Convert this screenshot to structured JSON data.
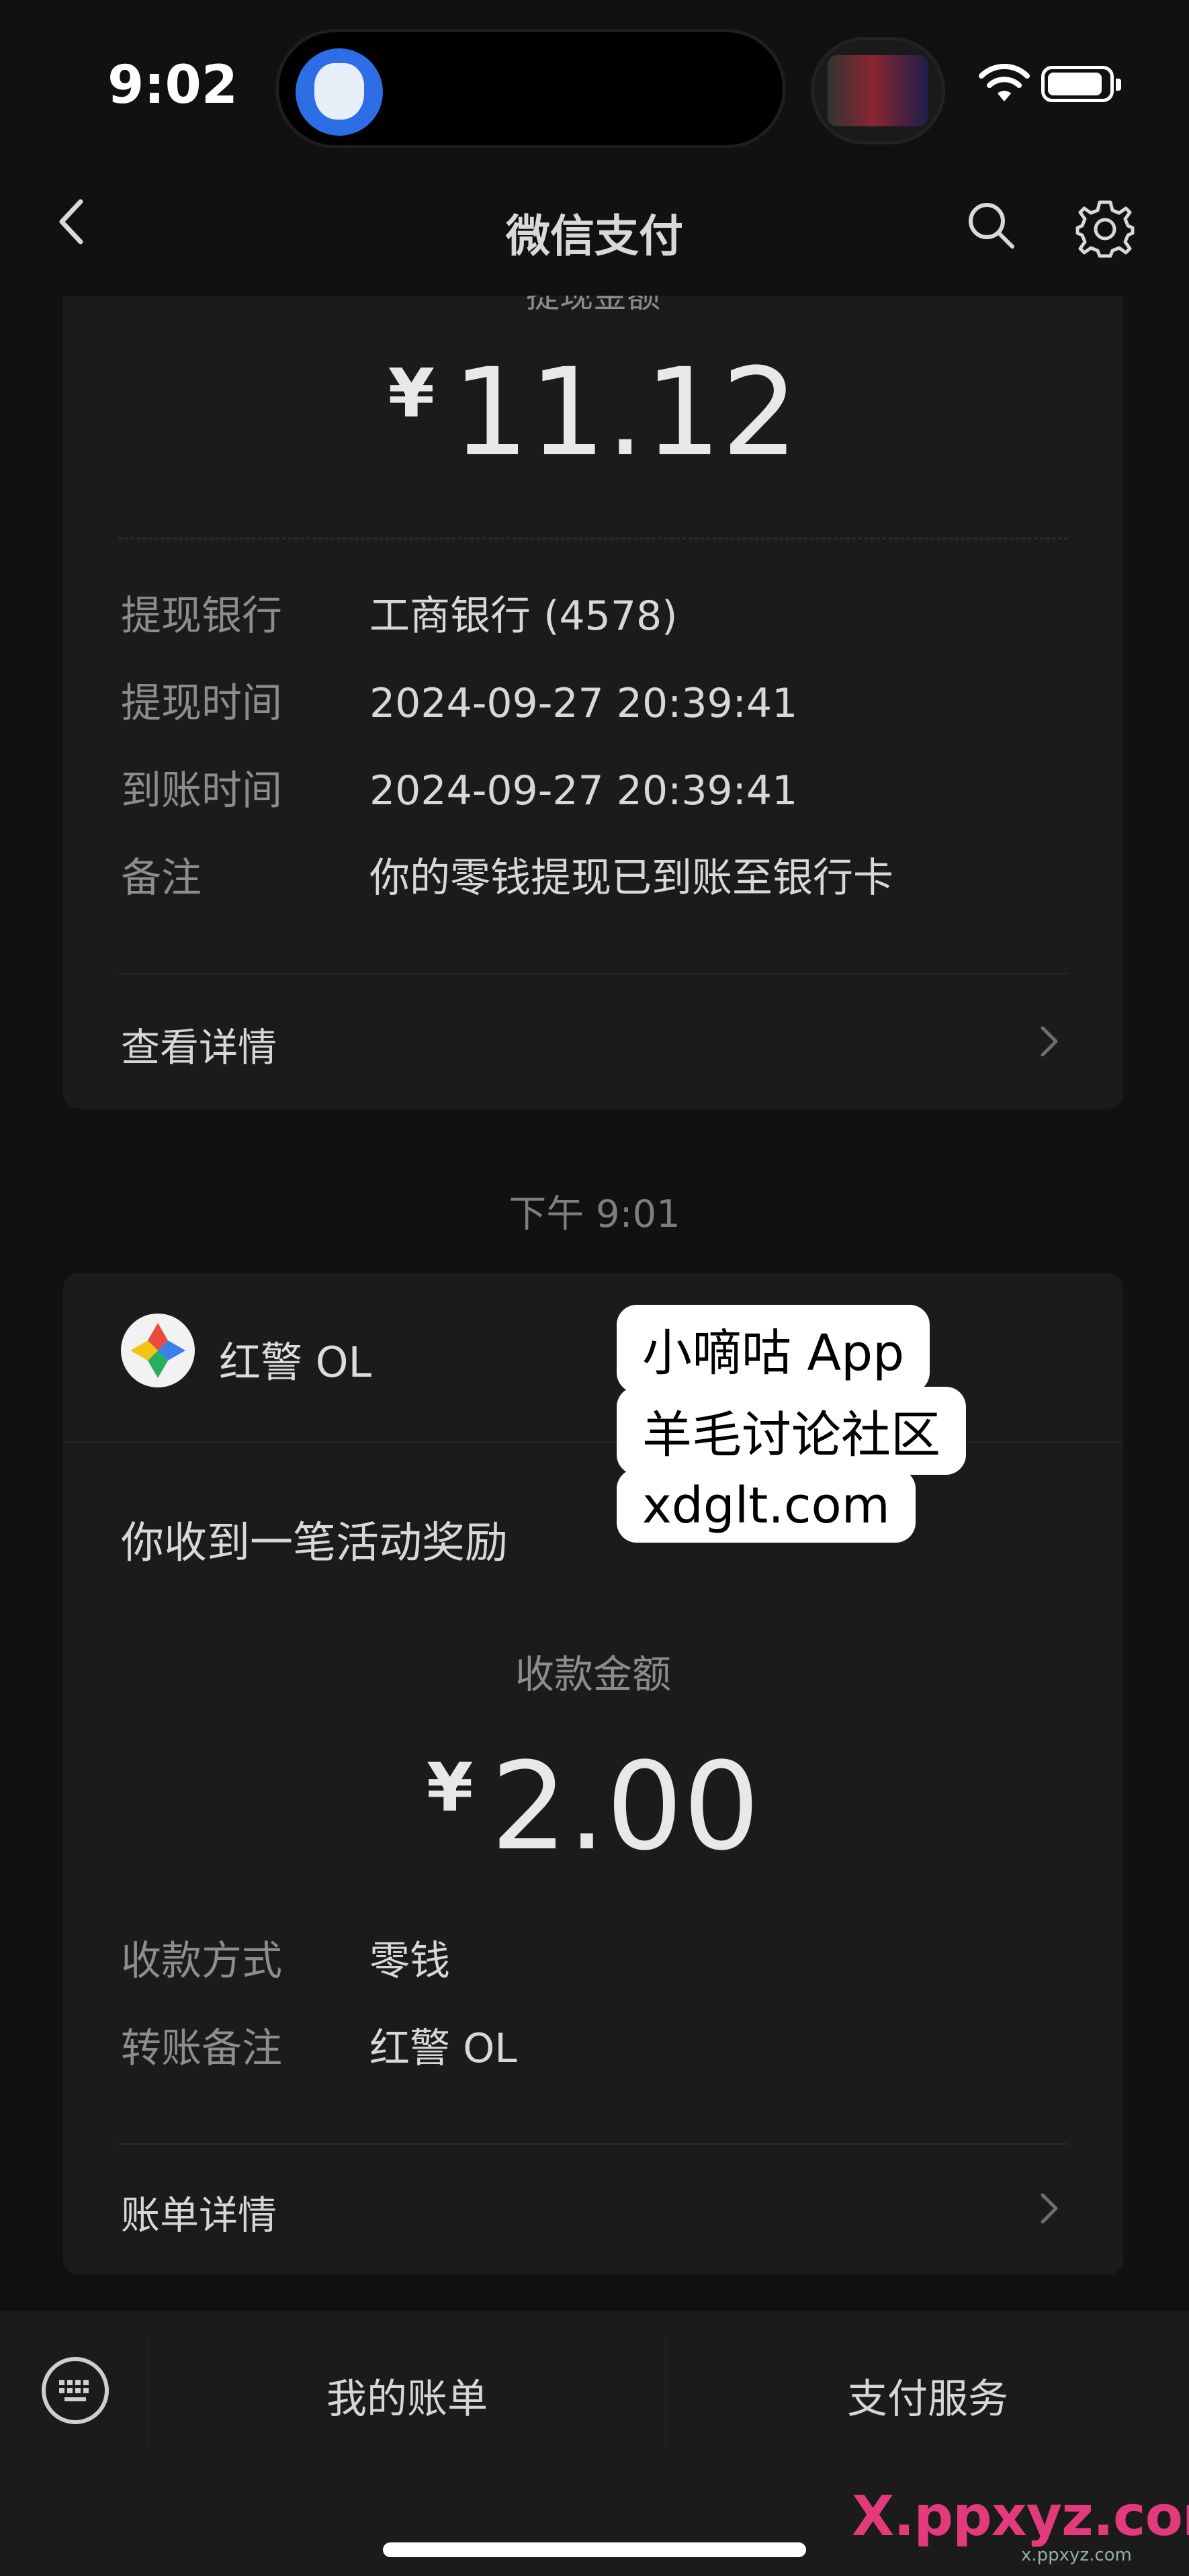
{
  "status_bar": {
    "time": "9:02"
  },
  "nav": {
    "title": "微信支付"
  },
  "card1": {
    "cut_label": "提现金额",
    "currency": "¥",
    "amount": "11.12",
    "rows": [
      {
        "label": "提现银行",
        "value": "工商银行 (4578)"
      },
      {
        "label": "提现时间",
        "value": "2024-09-27 20:39:41"
      },
      {
        "label": "到账时间",
        "value": "2024-09-27 20:39:41"
      },
      {
        "label": "备注",
        "value": "你的零钱提现已到账至银行卡"
      }
    ],
    "link": "查看详情"
  },
  "time_separator": "下午 9:01",
  "card2": {
    "app_name": "红警 OL",
    "message": "你收到一笔活动奖励",
    "amount_label": "收款金额",
    "currency": "¥",
    "amount": "2.00",
    "rows": [
      {
        "label": "收款方式",
        "value": "零钱"
      },
      {
        "label": "转账备注",
        "value": "红警 OL"
      }
    ],
    "link": "账单详情"
  },
  "sticker": {
    "line1": "小嘀咕 App",
    "line2": "羊毛讨论社区",
    "line3": "xdglt.com"
  },
  "bottom_bar": {
    "tab1": "我的账单",
    "tab2": "支付服务"
  },
  "watermark": {
    "main": "X.ppxyz.com",
    "sub": "x.ppxyz.com"
  },
  "icons": {
    "back": "chevron-left",
    "search": "search",
    "settings": "gear",
    "keyboard": "keyboard",
    "chevron": "chevron-right"
  },
  "colors": {
    "background": "#111111",
    "card": "#1b1b1b",
    "text": "#d6d6d6",
    "muted": "#8d8d8d"
  }
}
